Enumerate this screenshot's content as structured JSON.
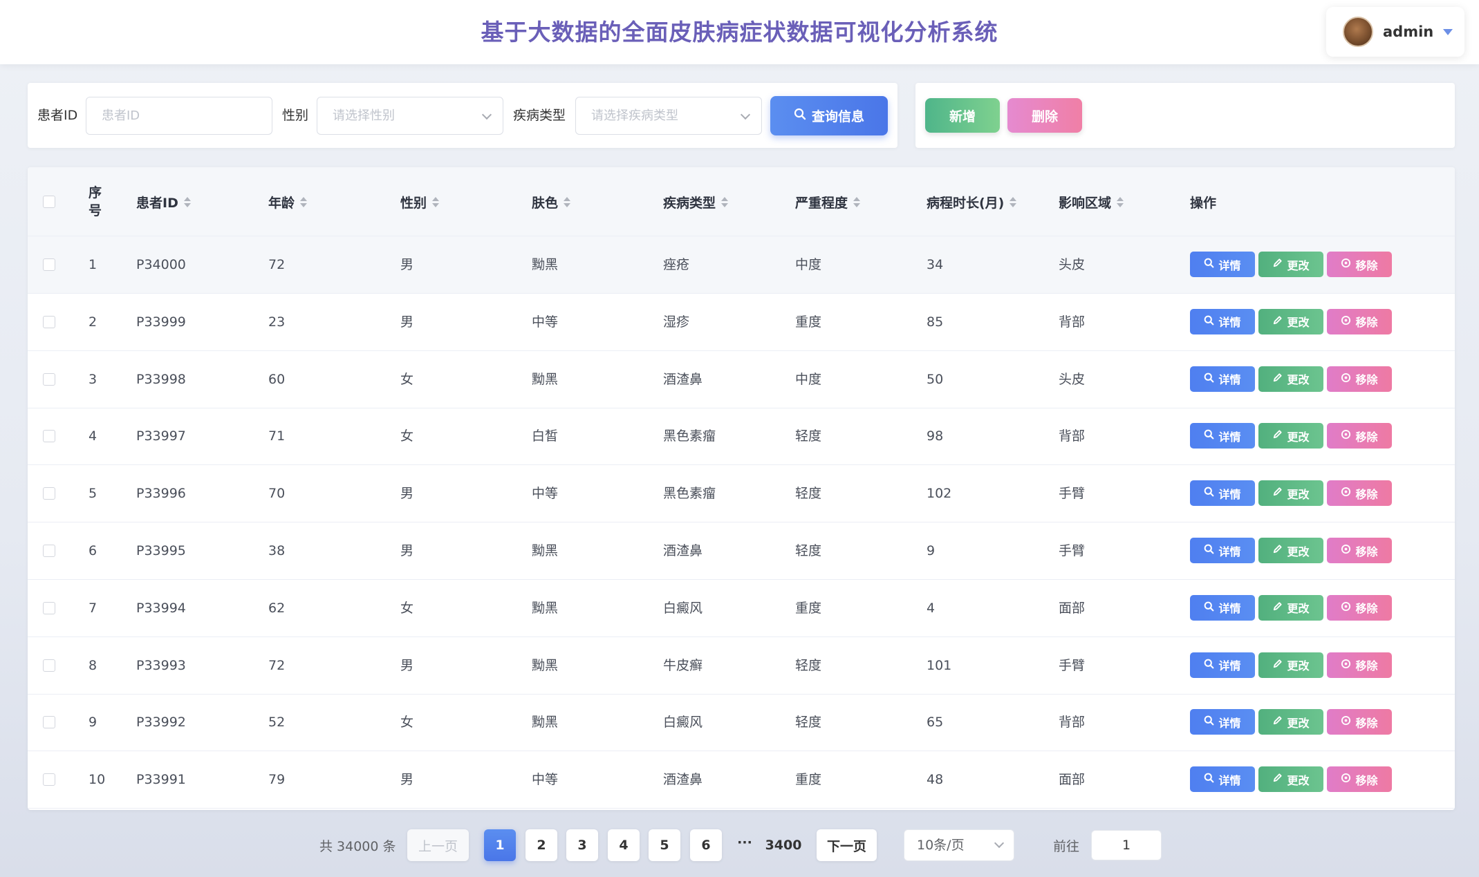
{
  "header": {
    "title": "基于大数据的全面皮肤病症状数据可视化分析系统",
    "user_name": "admin"
  },
  "search": {
    "patient_id_label": "患者ID",
    "patient_id_placeholder": "患者ID",
    "gender_label": "性别",
    "gender_placeholder": "请选择性别",
    "disease_label": "疾病类型",
    "disease_placeholder": "请选择疾病类型",
    "query_button": "查询信息"
  },
  "actions": {
    "add_button": "新增",
    "delete_button": "删除"
  },
  "table": {
    "columns": [
      "序号",
      "患者ID",
      "年龄",
      "性别",
      "肤色",
      "疾病类型",
      "严重程度",
      "病程时长(月)",
      "影响区域",
      "操作"
    ],
    "seq_header_line1": "序",
    "seq_header_line2": "号",
    "op_detail": "详情",
    "op_edit": "更改",
    "op_remove": "移除",
    "rows": [
      {
        "seq": "1",
        "id": "P34000",
        "age": "72",
        "gender": "男",
        "skin": "黝黑",
        "disease": "痤疮",
        "severity": "中度",
        "duration": "34",
        "area": "头皮"
      },
      {
        "seq": "2",
        "id": "P33999",
        "age": "23",
        "gender": "男",
        "skin": "中等",
        "disease": "湿疹",
        "severity": "重度",
        "duration": "85",
        "area": "背部"
      },
      {
        "seq": "3",
        "id": "P33998",
        "age": "60",
        "gender": "女",
        "skin": "黝黑",
        "disease": "酒渣鼻",
        "severity": "中度",
        "duration": "50",
        "area": "头皮"
      },
      {
        "seq": "4",
        "id": "P33997",
        "age": "71",
        "gender": "女",
        "skin": "白皙",
        "disease": "黑色素瘤",
        "severity": "轻度",
        "duration": "98",
        "area": "背部"
      },
      {
        "seq": "5",
        "id": "P33996",
        "age": "70",
        "gender": "男",
        "skin": "中等",
        "disease": "黑色素瘤",
        "severity": "轻度",
        "duration": "102",
        "area": "手臂"
      },
      {
        "seq": "6",
        "id": "P33995",
        "age": "38",
        "gender": "男",
        "skin": "黝黑",
        "disease": "酒渣鼻",
        "severity": "轻度",
        "duration": "9",
        "area": "手臂"
      },
      {
        "seq": "7",
        "id": "P33994",
        "age": "62",
        "gender": "女",
        "skin": "黝黑",
        "disease": "白癜风",
        "severity": "重度",
        "duration": "4",
        "area": "面部"
      },
      {
        "seq": "8",
        "id": "P33993",
        "age": "72",
        "gender": "男",
        "skin": "黝黑",
        "disease": "牛皮癣",
        "severity": "轻度",
        "duration": "101",
        "area": "手臂"
      },
      {
        "seq": "9",
        "id": "P33992",
        "age": "52",
        "gender": "女",
        "skin": "黝黑",
        "disease": "白癜风",
        "severity": "轻度",
        "duration": "65",
        "area": "背部"
      },
      {
        "seq": "10",
        "id": "P33991",
        "age": "79",
        "gender": "男",
        "skin": "中等",
        "disease": "酒渣鼻",
        "severity": "重度",
        "duration": "48",
        "area": "面部"
      }
    ]
  },
  "pagination": {
    "total": "共 34000 条",
    "prev": "上一页",
    "next": "下一页",
    "pages": [
      "1",
      "2",
      "3",
      "4",
      "5",
      "6"
    ],
    "current": "1",
    "ellipsis": "···",
    "last": "3400",
    "page_size": "10条/页",
    "goto_label": "前往",
    "goto_value": "1"
  }
}
